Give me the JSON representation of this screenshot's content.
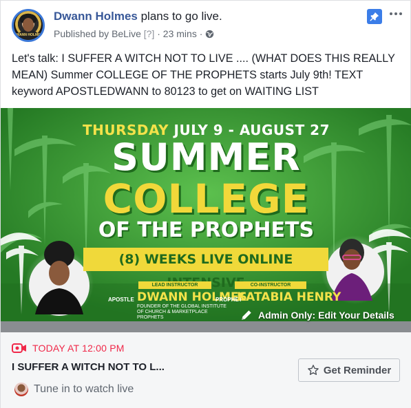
{
  "post": {
    "author": "Dwann Holmes",
    "action": "plans to go live.",
    "published_prefix": "Published by",
    "app": "BeLive",
    "help_marker": "[?]",
    "separator": "·",
    "time_ago": "23 mins",
    "separator2": "·",
    "privacy_icon": "globe-icon",
    "avatar_text": "DWANN HOLMES",
    "message": "Let's talk: I SUFFER A WITCH NOT TO LIVE .... (WHAT DOES THIS REALLY MEAN) Summer COLLEGE OF THE PROPHETS starts July 9th! TEXT keyword APOSTLEDWANN to 80123 to get on WAITING LIST"
  },
  "hero": {
    "dates_day": "THURSDAY",
    "dates_range": "JULY 9 - AUGUST 27",
    "line1": "SUMMER",
    "line2": "COLLEGE",
    "line3": "OF THE PROPHETS",
    "banner": "(8) WEEKS LIVE ONLINE INTENSIVE",
    "lead_tag": "LEAD INSTRUCTOR",
    "co_tag": "CO-INSTRUCTOR",
    "lead_prefix": "APOSTLE",
    "lead_name": "DWANN HOLMES",
    "lead_sub": "FOUNDER OF THE GLOBAL INSTITUTE OF CHURCH & MARKETPLACE PROPHETS",
    "co_prefix": "PROPHET",
    "co_name": "KATABIA HENRY",
    "admin_edit": "Admin Only: Edit Your Details"
  },
  "live": {
    "time": "TODAY AT 12:00 PM",
    "title": "I SUFFER A WITCH NOT TO L...",
    "reminder_label": "Get Reminder",
    "tune_in": "Tune in to watch live"
  },
  "colors": {
    "author_link": "#385898",
    "live_red": "#f02849",
    "pin_blue": "#3b7de8",
    "hero_green": "#3fa33a",
    "hero_yellow": "#f2d83a"
  }
}
